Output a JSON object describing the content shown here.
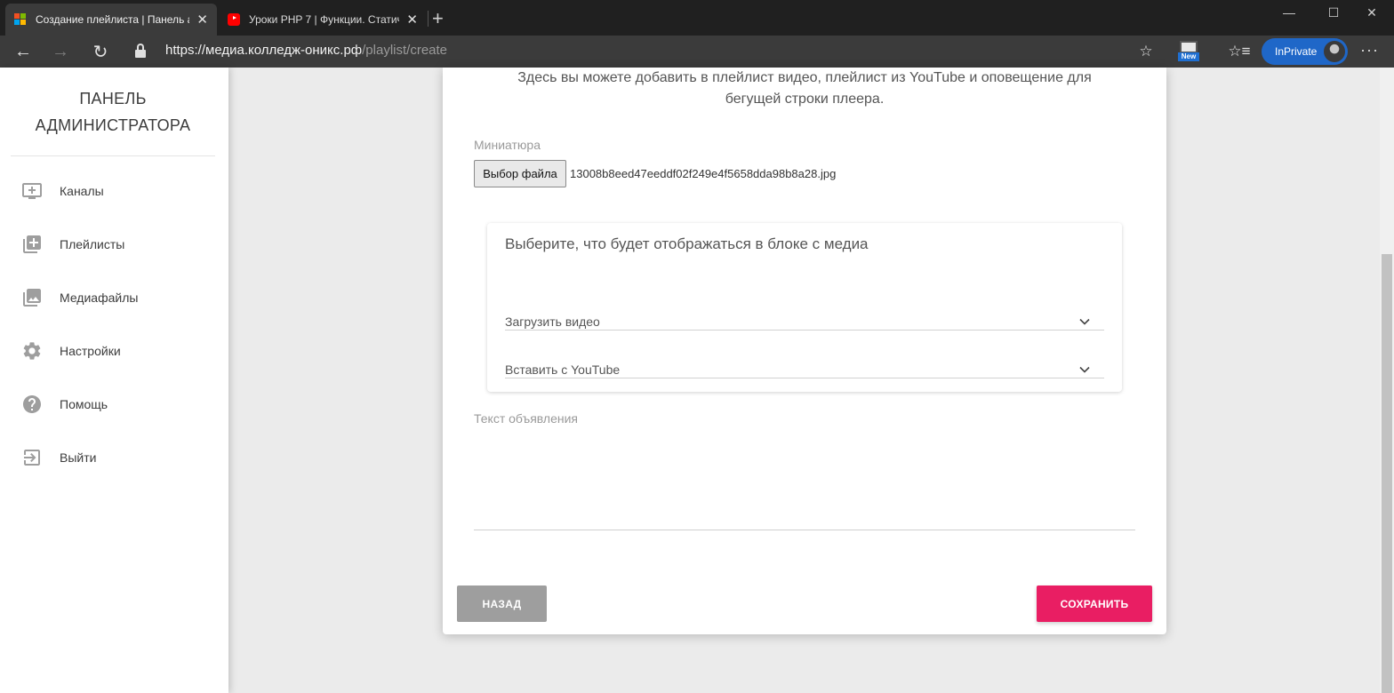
{
  "browser": {
    "tabs": [
      {
        "title": "Создание плейлиста | Панель а",
        "favicon": "microsoft-logo-icon",
        "active": true
      },
      {
        "title": "Уроки PHP 7 | Функции. Статич",
        "favicon": "youtube-icon",
        "active": false
      }
    ],
    "url": {
      "scheme": "https://",
      "host": "медиа.колледж-оникс.рф",
      "path": "/playlist/create"
    },
    "inprivate_label": "InPrivate",
    "new_badge": "New"
  },
  "sidebar": {
    "brand_line1": "ПАНЕЛЬ",
    "brand_line2": "АДМИНИСТРАТОРА",
    "items": [
      {
        "label": "Каналы",
        "icon": "add-to-queue-icon"
      },
      {
        "label": "Плейлисты",
        "icon": "library-add-icon"
      },
      {
        "label": "Медиафайлы",
        "icon": "photo-library-icon"
      },
      {
        "label": "Настройки",
        "icon": "gear-icon"
      },
      {
        "label": "Помощь",
        "icon": "help-icon"
      },
      {
        "label": "Выйти",
        "icon": "exit-icon"
      }
    ]
  },
  "form": {
    "intro_line1": "Здесь вы можете добавить в плейлист видео, плейлист из YouTube и оповещение для",
    "intro_line2": "бегущей строки плеера.",
    "thumbnail_label": "Миниатюра",
    "file_button": "Выбор файла",
    "file_name": "13008b8eed47eeddf02f249e4f5658dda98b8a28.jpg",
    "media_title": "Выберите, что будет отображаться в блоке с медиа",
    "upload_video": "Загрузить видео",
    "insert_youtube": "Вставить с YouTube",
    "announcement_label": "Текст объявления",
    "back_button": "НАЗАД",
    "save_button": "СОХРАНИТЬ"
  },
  "colors": {
    "accent": "#e91e63",
    "back_button": "#9e9e9e",
    "inprivate": "#1f67c8"
  }
}
